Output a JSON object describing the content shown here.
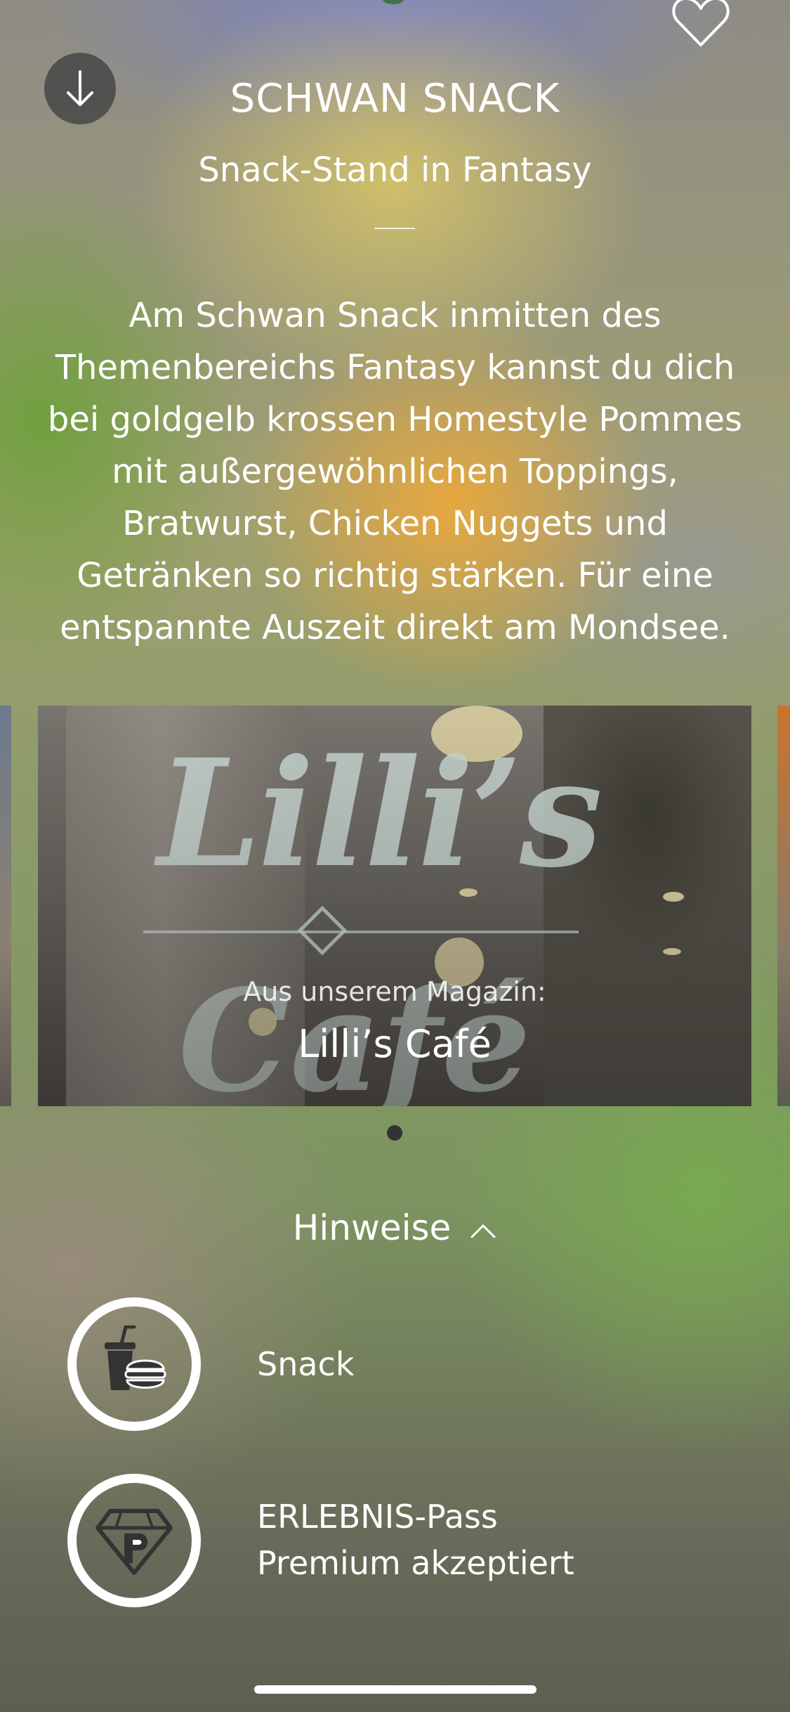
{
  "header": {
    "title": "SCHWAN SNACK",
    "subtitle": "Snack-Stand in Fantasy"
  },
  "description": "Am Schwan Snack inmitten des Themenbereichs Fantasy kannst du dich bei goldgelb krossen Homestyle Pommes mit außergewöhnlichen Toppings, Bratwurst, Chicken Nuggets und Getränken so richtig stärken. Für eine entspannte Auszeit direkt am Mondsee.",
  "carousel": {
    "card": {
      "kicker": "Aus unserem Magazin:",
      "title": "Lilli’s Café",
      "image_logo": "Lilli’s Café"
    },
    "page_count": 1,
    "active_page": 1
  },
  "notes": {
    "label": "Hinweise",
    "items": [
      {
        "icon": "snack-icon",
        "label": "Snack"
      },
      {
        "icon": "premium-pass-icon",
        "line1": "ERLEBNIS-Pass",
        "line2": "Premium akzeptiert"
      }
    ]
  },
  "icons": {
    "back": "arrow-down-icon",
    "favorite": "heart-icon",
    "toggle": "chevron-up-icon"
  }
}
